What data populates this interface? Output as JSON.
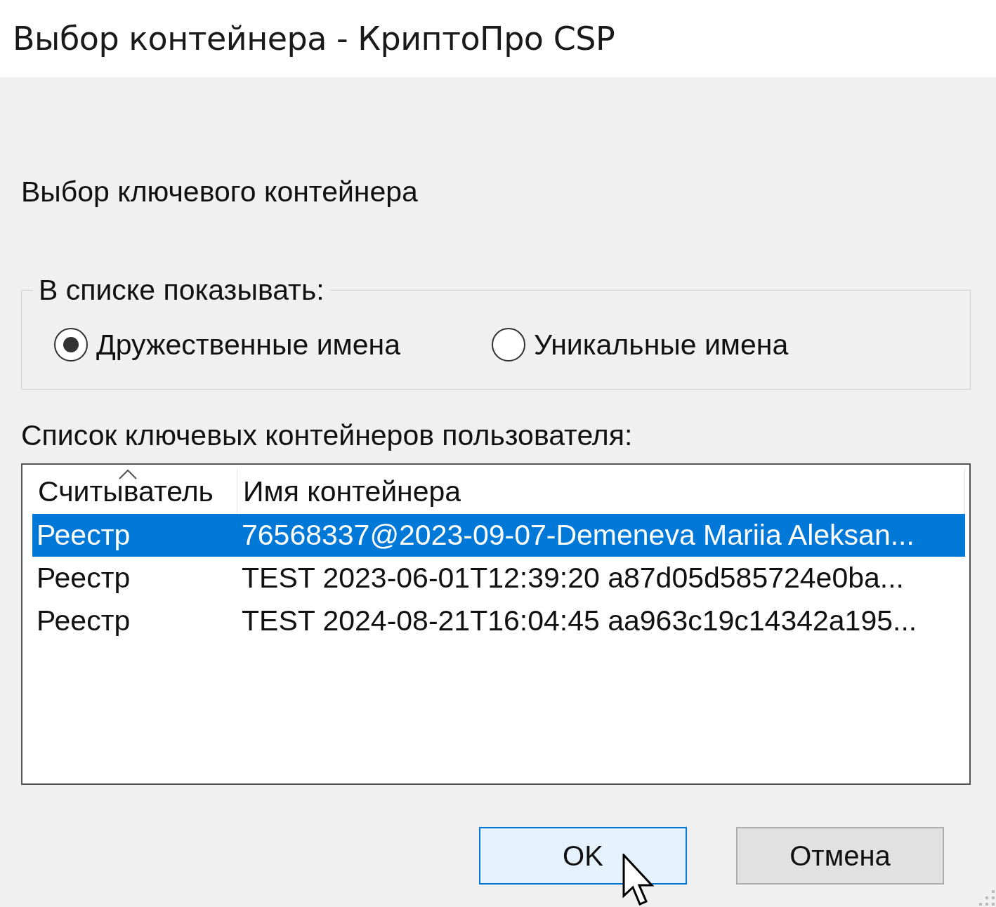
{
  "window": {
    "title": "Выбор контейнера - КриптоПро CSP"
  },
  "heading": "Выбор ключевого контейнера",
  "display_group": {
    "legend": "В списке показывать:",
    "options": [
      {
        "label": "Дружественные имена",
        "selected": true
      },
      {
        "label": "Уникальные имена",
        "selected": false
      }
    ]
  },
  "list_label": "Список ключевых контейнеров пользователя:",
  "table": {
    "columns": [
      {
        "label": "Считыватель",
        "sorted": true
      },
      {
        "label": "Имя контейнера",
        "sorted": false
      }
    ],
    "rows": [
      {
        "reader": "Реестр",
        "name": "76568337@2023-09-07-Demeneva Mariia Aleksan...",
        "selected": true
      },
      {
        "reader": "Реестр",
        "name": "TEST 2023-06-01T12:39:20 a87d05d585724e0ba...",
        "selected": false
      },
      {
        "reader": "Реестр",
        "name": "TEST 2024-08-21T16:04:45 aa963c19c14342a195...",
        "selected": false
      }
    ]
  },
  "buttons": [
    {
      "label": "OK",
      "kind": "default"
    },
    {
      "label": "Отмена",
      "kind": "normal"
    }
  ]
}
